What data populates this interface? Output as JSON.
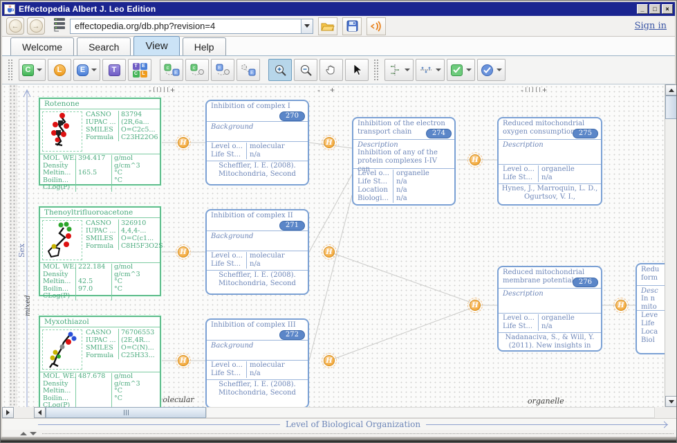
{
  "window": {
    "title": "Effectopedia  Albert J. Leo Edition",
    "minimize": "_",
    "maximize": "□",
    "close": "×"
  },
  "addressbar": {
    "url": "effectopedia.org/db.php?revision=4",
    "sign_in": "Sign in"
  },
  "tabs": {
    "welcome": "Welcome",
    "search": "Search",
    "view": "View",
    "help": "Help"
  },
  "toolbar": {
    "chemical": "C",
    "link": "L",
    "effect": "E",
    "text": "T",
    "grid_t": "T",
    "grid_e": "E",
    "grid_c": "C",
    "grid_l": "L"
  },
  "canvas": {
    "link_badge": "H",
    "zoom_minus": "-",
    "zoom_plus": "+",
    "y_axis_label": "Sex",
    "y_tick_mixed": "mixed",
    "x_tick_molecular": "molecular",
    "x_tick_organelle": "organelle",
    "x_axis_label": "Level of Biological Organization",
    "chemicals": [
      {
        "name": "Rotenone",
        "props": [
          {
            "label": "CASNO",
            "value": "83794"
          },
          {
            "label": "IUPAC ...",
            "value": "(2R,6a..."
          },
          {
            "label": "SMILES",
            "value": "O=C2c5..."
          },
          {
            "label": "Formula",
            "value": "C23H22O6"
          }
        ],
        "props2": [
          {
            "label": "MOL_WE...",
            "value": "394.417",
            "unit": "g/mol"
          },
          {
            "label": "Density",
            "value": "",
            "unit": "g/cm^3"
          },
          {
            "label": "Meltin...",
            "value": "165.5",
            "unit": "°C"
          },
          {
            "label": "Boilin...",
            "value": "",
            "unit": "°C"
          },
          {
            "label": "CLog(P)",
            "value": "",
            "unit": ""
          }
        ]
      },
      {
        "name": "Thenoyltrifluoroacetone",
        "props": [
          {
            "label": "CASNO",
            "value": "326910"
          },
          {
            "label": "IUPAC ...",
            "value": "4,4,4-..."
          },
          {
            "label": "SMILES",
            "value": "O=C(c1..."
          },
          {
            "label": "Formula",
            "value": "C8H5F3O2S"
          }
        ],
        "props2": [
          {
            "label": "MOL_WE...",
            "value": "222.184",
            "unit": "g/mol"
          },
          {
            "label": "Density",
            "value": "",
            "unit": "g/cm^3"
          },
          {
            "label": "Meltin...",
            "value": "42.5",
            "unit": "°C"
          },
          {
            "label": "Boilin...",
            "value": "97.0",
            "unit": "°C"
          },
          {
            "label": "CLog(P)",
            "value": "",
            "unit": ""
          }
        ]
      },
      {
        "name": "Myxothiazol",
        "props": [
          {
            "label": "CASNO",
            "value": "76706553"
          },
          {
            "label": "IUPAC ...",
            "value": "(2E,4R..."
          },
          {
            "label": "SMILES",
            "value": "O=C(N)..."
          },
          {
            "label": "Formula",
            "value": "C25H33..."
          }
        ],
        "props2": [
          {
            "label": "MOL_WE...",
            "value": "487.678",
            "unit": "g/mol"
          },
          {
            "label": "Density",
            "value": "",
            "unit": "g/cm^3"
          },
          {
            "label": "Meltin...",
            "value": "",
            "unit": "°C"
          },
          {
            "label": "Boilin...",
            "value": "",
            "unit": "°C"
          },
          {
            "label": "CLog(P)",
            "value": "",
            "unit": ""
          }
        ]
      }
    ],
    "events": [
      {
        "id": "270",
        "title": "Inhibition of complex I",
        "section": "Background",
        "fields": [
          {
            "label": "Level o...",
            "value": "molecular"
          },
          {
            "label": "Life St...",
            "value": "n/a"
          }
        ],
        "cit1": "Scheffler, I. E. (2008).",
        "cit2": "Mitochondria, Second"
      },
      {
        "id": "271",
        "title": "Inhibition of complex II",
        "section": "Background",
        "fields": [
          {
            "label": "Level o...",
            "value": "molecular"
          },
          {
            "label": "Life St...",
            "value": "n/a"
          }
        ],
        "cit1": "Scheffler, I. E. (2008).",
        "cit2": "Mitochondria, Second"
      },
      {
        "id": "272",
        "title": "Inhibition of complex III",
        "section": "Background",
        "fields": [
          {
            "label": "Level o...",
            "value": "molecular"
          },
          {
            "label": "Life St...",
            "value": "n/a"
          }
        ],
        "cit1": "Scheffler, I. E. (2008).",
        "cit2": "Mitochondria, Second"
      },
      {
        "id": "274",
        "title": "Inhibition of the electron transport chain",
        "section": "Description",
        "body1": "Inhibition of any of the",
        "body2": "protein complexes I-IV can",
        "fields": [
          {
            "label": "Level o...",
            "value": "organelle"
          },
          {
            "label": "Life St...",
            "value": "n/a"
          },
          {
            "label": "Location",
            "value": "n/a"
          },
          {
            "label": "Biologi...",
            "value": "n/a"
          }
        ]
      },
      {
        "id": "275",
        "title": "Reduced mitochondrial oxygen consumption",
        "section": "Description",
        "fields": [
          {
            "label": "Level o...",
            "value": "organelle"
          },
          {
            "label": "Life St...",
            "value": "n/a"
          }
        ],
        "cit1": "Hynes, J., Marroquin, L. D.,",
        "cit2": "Ogurtsov, V. I.,"
      },
      {
        "id": "276",
        "title": "Reduced mitochondrial membrane potential",
        "section": "Description",
        "fields": [
          {
            "label": "Level o...",
            "value": "organelle"
          },
          {
            "label": "Life St...",
            "value": "n/a"
          }
        ],
        "cit1": "Nadanaciva, S., & Will, Y.",
        "cit2": "(2011). New insights in"
      }
    ],
    "partial_event": {
      "title_l1": "Redu",
      "title_l2": "form",
      "section": "Desc",
      "body_l1": "In n",
      "body_l2": "mito",
      "f1": "Leve",
      "f2": "Life",
      "f3": "Loca",
      "f4": "Biol"
    }
  }
}
